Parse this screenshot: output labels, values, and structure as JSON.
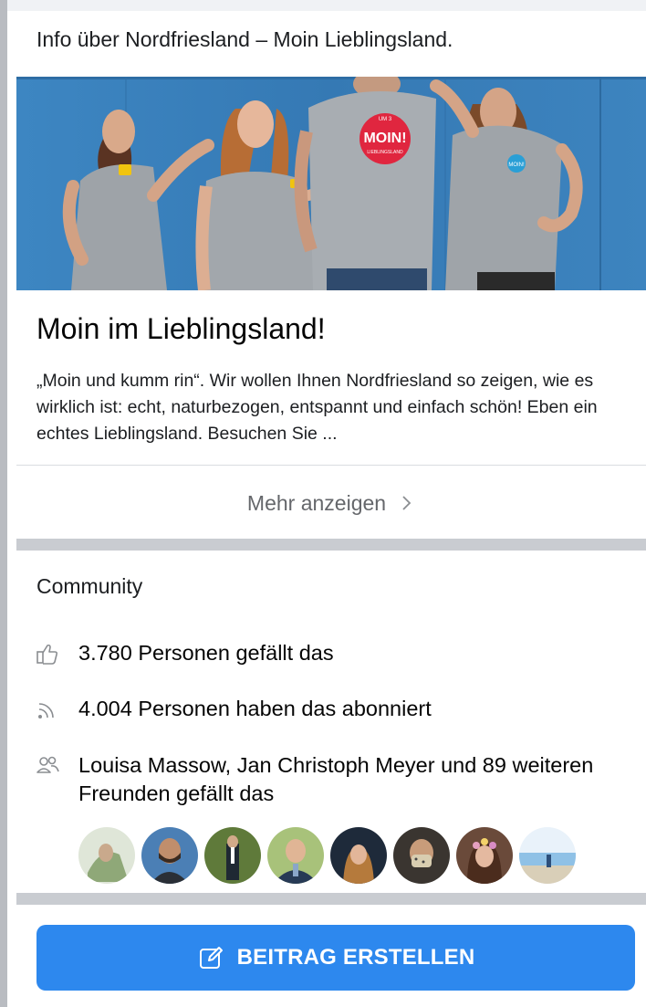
{
  "header": {
    "title": "Info über Nordfriesland – Moin Lieblingsland."
  },
  "cover": {
    "alt": "cover-photo",
    "badge_top": "UM 3",
    "badge_main": "MOIN!",
    "badge_sub": "LIEBLINGSLAND",
    "badge_small": "MOIN!",
    "colors": {
      "background": "#3b7fb8",
      "shirt": "#9ea3a8",
      "badge": "#e0263f"
    }
  },
  "about": {
    "title": "Moin im Lieblingsland!",
    "description": "„Moin und kumm rin“.  Wir wollen Ihnen Nordfriesland so zeigen, wie es wirklich ist: echt, naturbezogen, entspannt und einfach schön! Eben ein echtes Lieblingsland. Besuchen Sie ...",
    "more_label": "Mehr anzeigen"
  },
  "community": {
    "title": "Community",
    "likes": {
      "icon": "thumbs-up-icon",
      "text": "3.780 Personen gefällt das"
    },
    "followers": {
      "icon": "rss-icon",
      "text": "4.004 Personen haben das abonniert"
    },
    "friends": {
      "icon": "people-icon",
      "text": "Louisa Massow, Jan Christoph Meyer und 89 weiteren Freunden gefällt das"
    },
    "avatar_count": 8
  },
  "actions": {
    "create_label": "BEITRAG ERSTELLEN",
    "create_icon": "edit-icon"
  },
  "colors": {
    "accent": "#2d88ee",
    "separator": "#c9ccd1",
    "muted": "#65676b"
  }
}
